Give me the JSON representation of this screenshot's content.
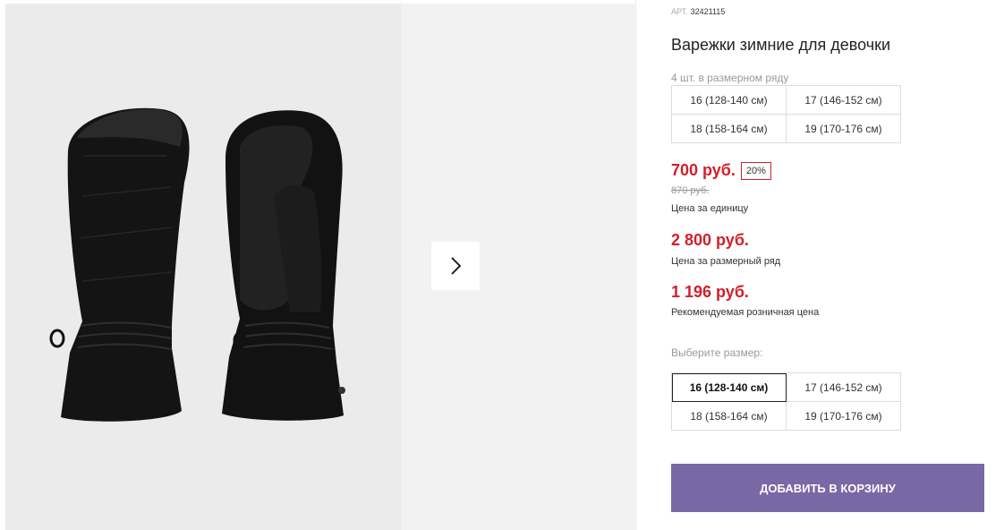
{
  "product": {
    "art_prefix": "АРТ.",
    "art_number": "32421115",
    "title": "Варежки зимние для девочки",
    "pack_note": "4 шт. в размерном ряду",
    "pack_sizes": [
      "16 (128-140 см)",
      "17 (146-152 см)",
      "18 (158-164 см)",
      "19 (170-176 см)"
    ]
  },
  "prices": {
    "unit": "700 руб.",
    "discount": "20%",
    "old": "870 руб.",
    "unit_caption": "Цена за единицу",
    "pack": "2 800 руб.",
    "pack_caption": "Цена за размерный ряд",
    "retail": "1 196 руб.",
    "retail_caption": "Рекомендуемая розничная цена"
  },
  "size_picker": {
    "label": "Выберите размер:",
    "options": [
      "16 (128-140 см)",
      "17 (146-152 см)",
      "18 (158-164 см)",
      "19 (170-176 см)"
    ],
    "selected": "16 (128-140 см)"
  },
  "cart_button": {
    "label": "ДОБАВИТЬ В КОРЗИНУ"
  },
  "colors": {
    "price_red": "#d0202b",
    "cart_purple": "#7a68a5"
  },
  "icons": {
    "next": "chevron-right-icon"
  }
}
